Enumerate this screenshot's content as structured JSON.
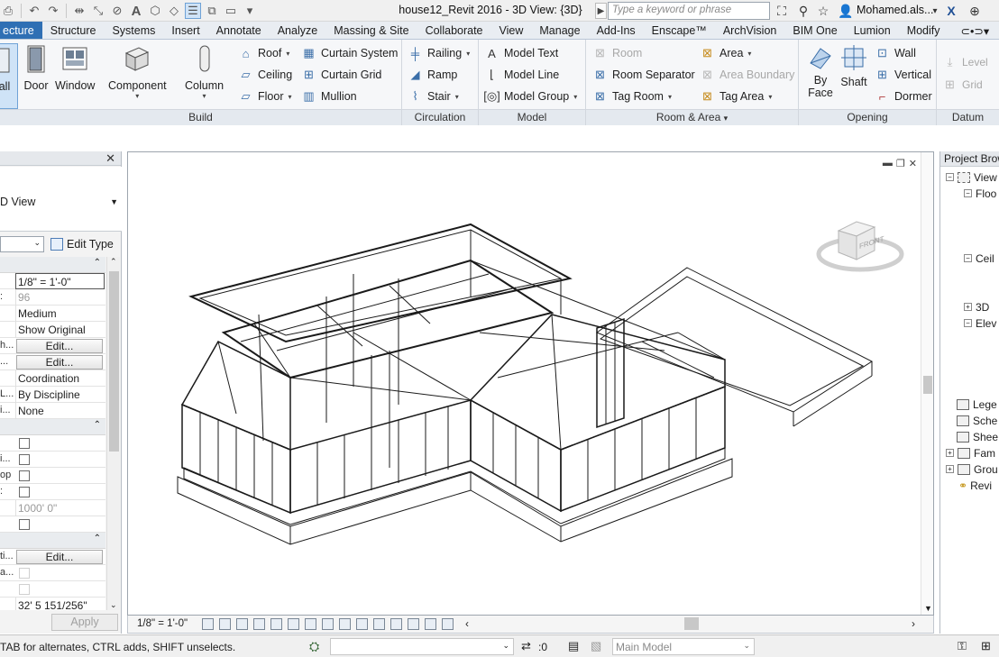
{
  "titlebar": {
    "title": "house12_Revit 2016 - 3D View: {3D}",
    "search_placeholder": "Type a keyword or phrase",
    "user": "Mohamed.als...",
    "dropdown": "▾"
  },
  "tabs": [
    "ecture",
    "Structure",
    "Systems",
    "Insert",
    "Annotate",
    "Analyze",
    "Massing & Site",
    "Collaborate",
    "View",
    "Manage",
    "Add-Ins",
    "Enscape™",
    "ArchVision",
    "BIM One",
    "Lumion",
    "Modify"
  ],
  "ribbon": {
    "build": {
      "label": "Build",
      "big": [
        "all",
        "Door",
        "Window",
        "Component",
        "Column"
      ],
      "roof": "Roof",
      "ceiling": "Ceiling",
      "floor": "Floor",
      "curtain_system": "Curtain System",
      "curtain_grid": "Curtain Grid",
      "mullion": "Mullion"
    },
    "circulation": {
      "label": "Circulation",
      "railing": "Railing",
      "ramp": "Ramp",
      "stair": "Stair"
    },
    "model": {
      "label": "Model",
      "text": "Model Text",
      "line": "Model Line",
      "group": "Model Group"
    },
    "room": {
      "label": "Room & Area",
      "room": "Room",
      "separator": "Room Separator",
      "tag_room": "Tag Room",
      "area": "Area",
      "boundary": "Area Boundary",
      "tag_area": "Tag Area"
    },
    "opening": {
      "label": "Opening",
      "by_face_1": "By",
      "by_face_2": "Face",
      "shaft": "Shaft",
      "wall": "Wall",
      "vertical": "Vertical",
      "dormer": "Dormer"
    },
    "datum": {
      "label": "Datum",
      "level": "Level",
      "grid": "Grid"
    }
  },
  "properties": {
    "type_name": "D View",
    "edit_type": "Edit Type",
    "rows": [
      {
        "name": "",
        "value": "1/8\" = 1'-0\""
      },
      {
        "name": ":",
        "value": "96"
      },
      {
        "name": "",
        "value": "Medium"
      },
      {
        "name": "",
        "value": "Show Original"
      },
      {
        "name": "h...",
        "value": "Edit..."
      },
      {
        "name": "...",
        "value": "Edit..."
      },
      {
        "name": "",
        "value": "Coordination"
      },
      {
        "name": "L...",
        "value": "By Discipline"
      },
      {
        "name": "i...",
        "value": "None"
      },
      {
        "name": "i...",
        "value": ""
      },
      {
        "name": "op",
        "value": ""
      },
      {
        "name": "",
        "value": "1000'  0\""
      },
      {
        "name": "ti...",
        "value": "Edit..."
      },
      {
        "name": "a...",
        "value": ""
      },
      {
        "name": "",
        "value": "32'  5 151/256\""
      }
    ],
    "apply": "Apply"
  },
  "viewport": {
    "scale": "1/8\" = 1'-0\"",
    "viewcube_face": "FRONT",
    "viewcube_top": "TOP"
  },
  "browser": {
    "title": "Project Brow",
    "items": [
      "View",
      "Floo",
      "Ceil",
      "3D",
      "Elev",
      "Lege",
      "Sche",
      "Shee",
      "Fam",
      "Grou",
      "Revi"
    ]
  },
  "status": {
    "message": "TAB for alternates, CTRL adds, SHIFT unselects.",
    "count": ":0",
    "model": "Main Model"
  }
}
